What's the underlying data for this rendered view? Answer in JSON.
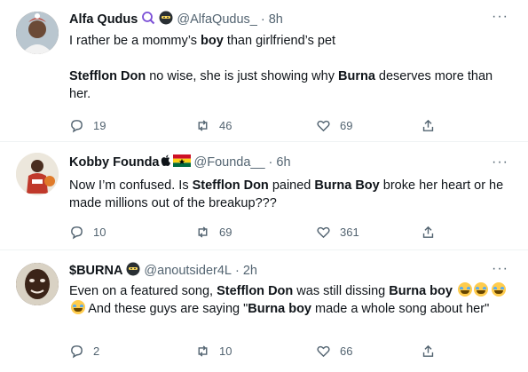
{
  "tweets": [
    {
      "name": "Alfa Qudus",
      "handle": "@AlfaQudus_",
      "dot": "·",
      "time": "8h",
      "more": "···",
      "line1_pre": "I rather be a mommy’s ",
      "line1_bold": "boy",
      "line1_post": " than girlfriend’s pet",
      "p2_bold1": "Stefflon Don",
      "p2_mid": " no wise, she is just showing why ",
      "p2_bold2": "Burna",
      "p2_post": " deserves more than her.",
      "replies": "19",
      "retweets": "46",
      "likes": "69"
    },
    {
      "name": "Kobby Founda",
      "handle": "@Founda__",
      "dot": "·",
      "time": "6h",
      "more": "···",
      "t1": "Now I’m confused. Is ",
      "b1": "Stefflon Don",
      "t2": " pained ",
      "b2": "Burna Boy",
      "t3": " broke her heart or he made millions out of the breakup???",
      "replies": "10",
      "retweets": "69",
      "likes": "361"
    },
    {
      "name": "$BURNA",
      "handle": "@anoutsider4L",
      "dot": "·",
      "time": "2h",
      "more": "···",
      "t1": "Even on a featured song, ",
      "b1": "Stefflon Don",
      "t2": " was still dissing ",
      "b2": "Burna boy",
      "t3": " And these guys are saying \"",
      "b3": "Burna boy",
      "t4": " made a whole song about her\"",
      "replies": "2",
      "retweets": "10",
      "likes": "66"
    }
  ],
  "icons": [
    "reply-icon",
    "retweet-icon",
    "like-icon",
    "share-icon",
    "more-icon",
    "emoji-joy-icon"
  ],
  "colors": {
    "text": "#0f1419",
    "muted": "#536471",
    "divider": "#eff3f4",
    "ghana_red": "#ce1126",
    "ghana_gold": "#fcd116",
    "ghana_green": "#006b3f"
  }
}
